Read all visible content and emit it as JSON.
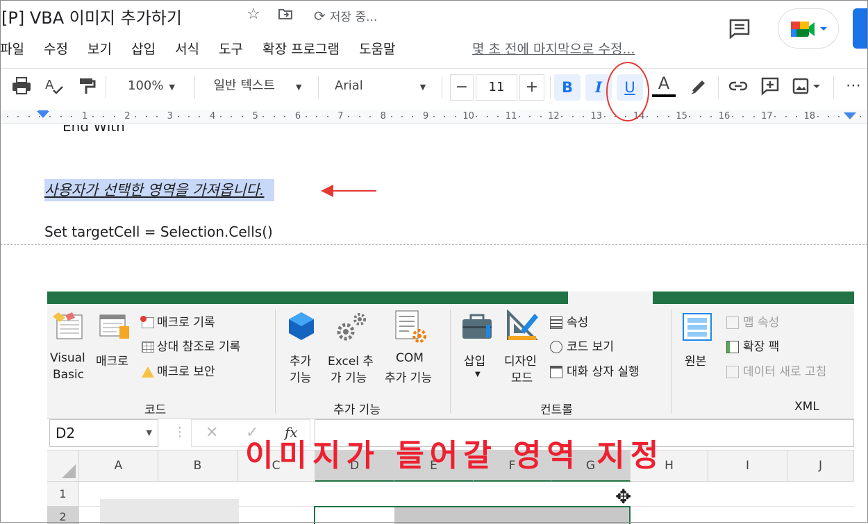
{
  "app": {
    "doc_title": "[P] VBA 이미지 추가하기",
    "saving_status": "저장 중...",
    "last_edit": "몇 초 전에 마지막으로 수정...",
    "menu": [
      "파일",
      "수정",
      "보기",
      "삽입",
      "서식",
      "도구",
      "확장 프로그램",
      "도움말"
    ]
  },
  "toolbar": {
    "zoom": "100%",
    "style": "일반 텍스트",
    "font": "Arial",
    "font_size": "11",
    "minus": "−",
    "plus": "+",
    "bold": "B",
    "italic": "I",
    "underline": "U",
    "text_color": "A",
    "more": "⋯"
  },
  "ruler": {
    "numbers": [
      "1",
      "2",
      "3",
      "4",
      "5",
      "6",
      "7",
      "8",
      "9",
      "10",
      "11",
      "12",
      "13",
      "14",
      "15",
      "16",
      "17",
      "18"
    ]
  },
  "document": {
    "cut_line": "End With",
    "highlighted_line": "사용자가 선택한 영역을 가져옵니다.",
    "code_line": "Set targetCell = Selection.Cells()"
  },
  "excel": {
    "ribbon": {
      "code_group": {
        "visual_basic_line1": "Visual",
        "visual_basic_line2": "Basic",
        "macro": "매크로",
        "record_macro": "매크로 기록",
        "relative_ref": "상대 참조로 기록",
        "macro_security": "매크로 보안",
        "title": "코드"
      },
      "addins_group": {
        "addins_line1": "추가",
        "addins_line2": "기능",
        "excel_addins_line1": "Excel 추",
        "excel_addins_line2": "가 기능",
        "com_addins_line1": "COM",
        "com_addins_line2": "추가 기능",
        "title": "추가 기능"
      },
      "controls_group": {
        "insert": "삽입",
        "design_mode_line1": "디자인",
        "design_mode_line2": "모드",
        "properties": "속성",
        "view_code": "코드 보기",
        "run_dialog": "대화 상자 실행",
        "title": "컨트롤"
      },
      "xml_group": {
        "source": "원본",
        "map_properties": "맵 속성",
        "expansion_packs": "확장 팩",
        "refresh_data": "데이터 새로 고침",
        "title": "XML"
      }
    },
    "name_box": "D2",
    "fx": "fx",
    "columns": [
      "A",
      "B",
      "C",
      "D",
      "E",
      "F",
      "G",
      "H",
      "I",
      "J"
    ],
    "rows": [
      "1",
      "2"
    ],
    "overlay_title": "이미지가 들어갈 영역 지정"
  }
}
